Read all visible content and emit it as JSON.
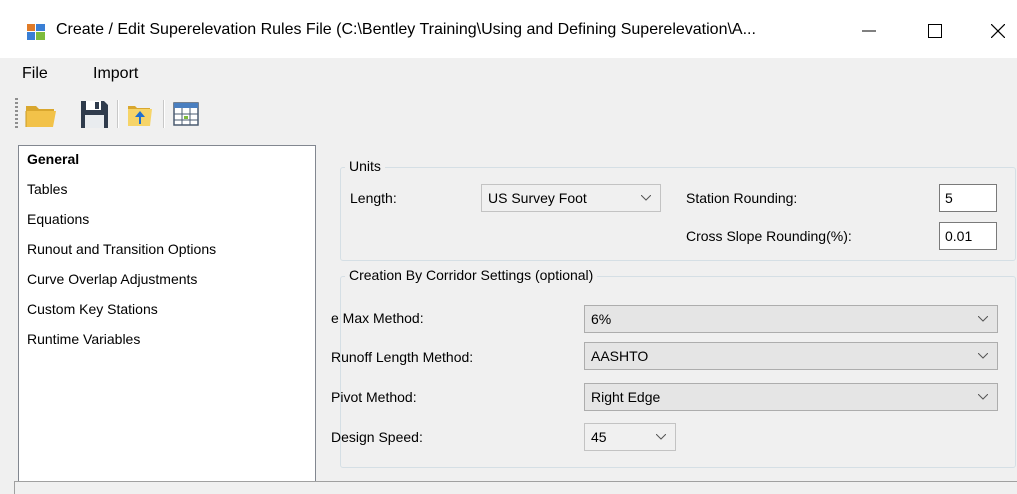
{
  "window": {
    "title": "Create / Edit Superelevation Rules File (C:\\Bentley Training\\Using and Defining Superelevation\\A...",
    "icon": "app-grid-icon",
    "controls": [
      "minimize-icon",
      "maximize-icon",
      "close-icon"
    ]
  },
  "menu": {
    "file": "File",
    "import": "Import"
  },
  "toolbar": {
    "buttons": [
      "open-folder-icon",
      "save-icon",
      "import-folder-icon",
      "table-grid-icon"
    ]
  },
  "sidebar": {
    "items": [
      {
        "label": "General",
        "selected": true
      },
      {
        "label": "Tables"
      },
      {
        "label": "Equations"
      },
      {
        "label": "Runout and Transition Options"
      },
      {
        "label": "Curve Overlap Adjustments"
      },
      {
        "label": "Custom Key Stations"
      },
      {
        "label": "Runtime Variables"
      }
    ]
  },
  "units": {
    "legend": "Units",
    "length_label": "Length:",
    "length_value": "US Survey Foot",
    "station_rounding_label": "Station Rounding:",
    "station_rounding_value": "5",
    "cross_slope_label": "Cross Slope Rounding(%):",
    "cross_slope_value": "0.01"
  },
  "corridor": {
    "legend": "Creation By Corridor Settings (optional)",
    "emax_label": "e Max Method:",
    "emax_value": "6%",
    "runoff_label": "Runoff Length Method:",
    "runoff_value": "AASHTO",
    "pivot_label": "Pivot Method:",
    "pivot_value": "Right Edge",
    "speed_label": "Design Speed:",
    "speed_value": "45"
  },
  "colors": {
    "accent_blue": "#1e6fd0",
    "folder_yellow": "#f2c249",
    "save_dark": "#2f3b4c"
  }
}
